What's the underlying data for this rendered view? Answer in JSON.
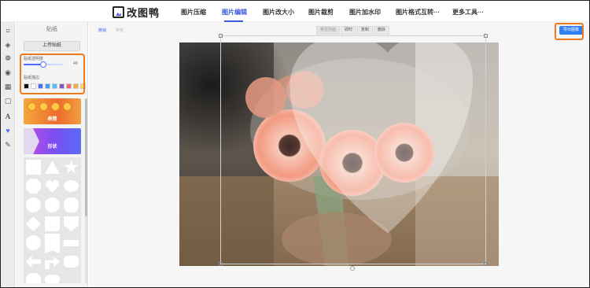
{
  "brand": {
    "name": "改图鸭"
  },
  "nav": [
    {
      "label": "图片压缩",
      "active": false
    },
    {
      "label": "图片编辑",
      "active": true
    },
    {
      "label": "图片改大小",
      "active": false
    },
    {
      "label": "图片裁剪",
      "active": false
    },
    {
      "label": "图片加水印",
      "active": false
    },
    {
      "label": "图片格式互转···",
      "active": false
    },
    {
      "label": "更多工具···",
      "active": false
    }
  ],
  "rail": {
    "icons": [
      "crop-icon",
      "drop-icon",
      "filter-icon",
      "adjust-icon",
      "mosaic-icon",
      "frame-icon",
      "text-icon",
      "sticker-icon",
      "brush-icon"
    ],
    "active": "sticker-icon"
  },
  "panel": {
    "title": "贴纸",
    "upload_label": "上传贴纸",
    "opacity_label": "贴纸透明度",
    "opacity_value": "49",
    "opacity_fraction": 0.49,
    "stroke_label": "贴纸描边",
    "stroke_colors": [
      "#111111",
      "#ffffff",
      "#4d6bfe",
      "#3aa0f5",
      "#4fc3f7",
      "#7e57c2",
      "#f26b6b",
      "#f7a94a",
      "#f5e04a"
    ],
    "sticker_packs": [
      {
        "label": "表情"
      },
      {
        "label": "形状"
      }
    ],
    "accent": "#4d6bfe",
    "highlight_color": "#f07a1a"
  },
  "toolbar": {
    "undo": "撤销",
    "redo": "恢复",
    "bring_forward": "移至前面",
    "copy_time": "即时",
    "duplicate": "复制",
    "delete": "删除"
  },
  "export": {
    "label": "导出图像",
    "color": "#2f7ff5"
  }
}
